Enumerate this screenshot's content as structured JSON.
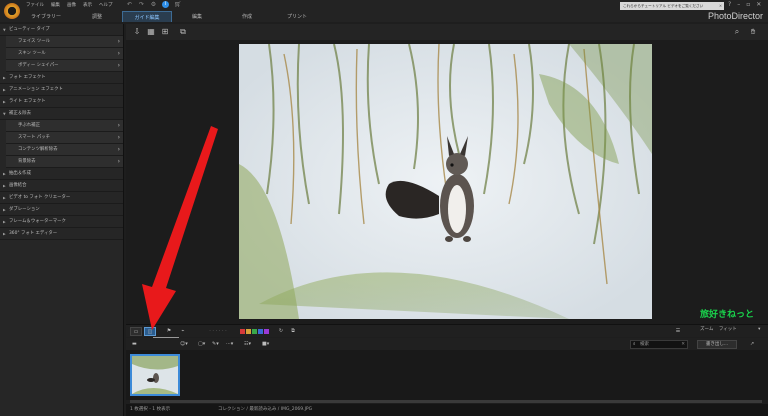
{
  "app": {
    "name": "PhotoDirector"
  },
  "menu": [
    "ファイル",
    "編集",
    "画像",
    "表示",
    "ヘルプ"
  ],
  "tabs": [
    {
      "label": "ライブラリー",
      "active": false
    },
    {
      "label": "調整",
      "active": false
    },
    {
      "label": "ガイド編集",
      "active": true
    },
    {
      "label": "編集",
      "active": false
    },
    {
      "label": "作成",
      "active": false
    },
    {
      "label": "プリント",
      "active": false
    }
  ],
  "notice": {
    "text": "これらからチュートリアル ビデオをご覧ください"
  },
  "left_panel": [
    {
      "label": "ビューティー タイプ",
      "type": "header",
      "open": true
    },
    {
      "label": "フェイス ツール",
      "type": "sub"
    },
    {
      "label": "スキン ツール",
      "type": "sub"
    },
    {
      "label": "ボディー シェイパー",
      "type": "sub"
    },
    {
      "label": "フォト エフェクト",
      "type": "header",
      "open": false
    },
    {
      "label": "アニメーション エフェクト",
      "type": "header",
      "open": false
    },
    {
      "label": "ライト エフェクト",
      "type": "header",
      "open": false
    },
    {
      "label": "補正＆除去",
      "type": "header",
      "open": true
    },
    {
      "label": "手ぶれ補正",
      "type": "sub"
    },
    {
      "label": "スマート パッチ",
      "type": "sub"
    },
    {
      "label": "コンテンツ解析除去",
      "type": "sub"
    },
    {
      "label": "背景除去",
      "type": "sub"
    },
    {
      "label": "抽出＆作成",
      "type": "header",
      "open": false
    },
    {
      "label": "画像結合",
      "type": "header",
      "open": false
    },
    {
      "label": "ビデオ to フォト クリエーター",
      "type": "header",
      "open": false
    },
    {
      "label": "ダブレーション",
      "type": "header",
      "open": false
    },
    {
      "label": "フレーム＆ウォーターマーク",
      "type": "header",
      "open": false
    },
    {
      "label": "360° フォト エディター",
      "type": "header",
      "open": false
    }
  ],
  "controls": {
    "tooltip": "前後の比較",
    "zoom_label": "ズーム",
    "zoom_value": "フィット"
  },
  "search": {
    "placeholder": "検索"
  },
  "export": {
    "label": "書き出し..."
  },
  "watermark": "旅好きねっと",
  "status": {
    "selection": "1 枚選択 - 1 枚表示",
    "path": "コレクション / 最新読み込み / IMG_2069.JPG"
  },
  "colors": {
    "accent": "#3c8ad8",
    "arrow": "#e8191b",
    "watermark": "#19d44c"
  },
  "icons": [
    "search-icon",
    "hand-icon",
    "rotate-icon",
    "compare-icon",
    "grid-icon",
    "export-icon"
  ]
}
